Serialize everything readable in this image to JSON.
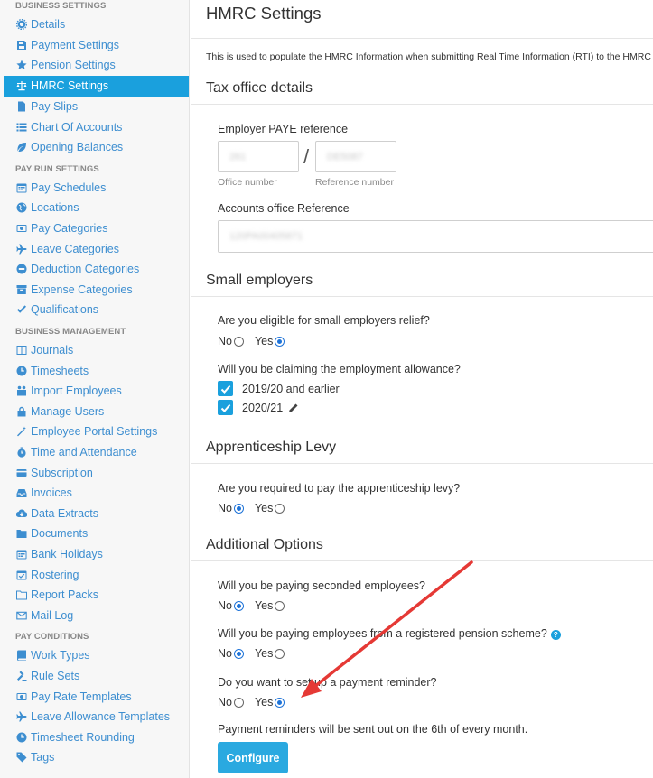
{
  "sidebar": {
    "sections": [
      {
        "title": "BUSINESS SETTINGS",
        "items": [
          {
            "label": "Details",
            "icon": "gear-icon"
          },
          {
            "label": "Payment Settings",
            "icon": "save-icon"
          },
          {
            "label": "Pension Settings",
            "icon": "star-icon"
          },
          {
            "label": "HMRC Settings",
            "icon": "scale-icon",
            "active": true
          },
          {
            "label": "Pay Slips",
            "icon": "file-icon"
          },
          {
            "label": "Chart Of Accounts",
            "icon": "list-icon"
          },
          {
            "label": "Opening Balances",
            "icon": "leaf-icon"
          }
        ]
      },
      {
        "title": "PAY RUN SETTINGS",
        "items": [
          {
            "label": "Pay Schedules",
            "icon": "calendar-icon"
          },
          {
            "label": "Locations",
            "icon": "globe-icon"
          },
          {
            "label": "Pay Categories",
            "icon": "money-icon"
          },
          {
            "label": "Leave Categories",
            "icon": "plane-icon"
          },
          {
            "label": "Deduction Categories",
            "icon": "minus-circle-icon"
          },
          {
            "label": "Expense Categories",
            "icon": "archive-icon"
          },
          {
            "label": "Qualifications",
            "icon": "check-icon"
          }
        ]
      },
      {
        "title": "BUSINESS MANAGEMENT",
        "items": [
          {
            "label": "Journals",
            "icon": "columns-icon"
          },
          {
            "label": "Timesheets",
            "icon": "clock-icon"
          },
          {
            "label": "Import Employees",
            "icon": "users-icon"
          },
          {
            "label": "Manage Users",
            "icon": "lock-icon"
          },
          {
            "label": "Employee Portal Settings",
            "icon": "magic-wand-icon"
          },
          {
            "label": "Time and Attendance",
            "icon": "stopwatch-icon"
          },
          {
            "label": "Subscription",
            "icon": "credit-card-icon"
          },
          {
            "label": "Invoices",
            "icon": "inbox-icon"
          },
          {
            "label": "Data Extracts",
            "icon": "cloud-download-icon"
          },
          {
            "label": "Documents",
            "icon": "folder-icon"
          },
          {
            "label": "Bank Holidays",
            "icon": "calendar-icon"
          },
          {
            "label": "Rostering",
            "icon": "calendar-check-icon"
          },
          {
            "label": "Report Packs",
            "icon": "folder-open-icon"
          },
          {
            "label": "Mail Log",
            "icon": "envelope-icon"
          }
        ]
      },
      {
        "title": "PAY CONDITIONS",
        "items": [
          {
            "label": "Work Types",
            "icon": "book-icon"
          },
          {
            "label": "Rule Sets",
            "icon": "gavel-icon"
          },
          {
            "label": "Pay Rate Templates",
            "icon": "money-icon"
          },
          {
            "label": "Leave Allowance Templates",
            "icon": "plane-icon"
          },
          {
            "label": "Timesheet Rounding",
            "icon": "clock-icon"
          },
          {
            "label": "Tags",
            "icon": "tag-icon"
          }
        ]
      }
    ]
  },
  "main": {
    "title": "HMRC Settings",
    "intro": "This is used to populate the HMRC Information when submitting Real Time Information (RTI) to the HMRC",
    "tax_office": {
      "heading": "Tax office details",
      "paye_label": "Employer PAYE reference",
      "office_number_value": "261",
      "office_number_label": "Office number",
      "separator": "/",
      "reference_number_value": "DE5087",
      "reference_number_label": "Reference number",
      "accounts_office_label": "Accounts office Reference",
      "accounts_office_value": "120PA00405871"
    },
    "small_employers": {
      "heading": "Small employers",
      "relief_question": "Are you eligible for small employers relief?",
      "relief_options": [
        "No",
        "Yes"
      ],
      "relief_selected": "Yes",
      "allowance_question": "Will you be claiming the employment allowance?",
      "allowance_years": [
        {
          "label": "2019/20 and earlier",
          "checked": true
        },
        {
          "label": "2020/21",
          "checked": true
        }
      ]
    },
    "apprenticeship": {
      "heading": "Apprenticeship Levy",
      "question": "Are you required to pay the apprenticeship levy?",
      "options": [
        "No",
        "Yes"
      ],
      "selected": "No"
    },
    "additional": {
      "heading": "Additional Options",
      "seconded_question": "Will you be paying seconded employees?",
      "seconded_selected": "No",
      "pension_question": "Will you be paying employees from a registered pension scheme?",
      "pension_selected": "No",
      "reminder_question": "Do you want to set up a payment reminder?",
      "reminder_selected": "Yes",
      "options": [
        "No",
        "Yes"
      ],
      "reminder_note": "Payment reminders will be sent out on the 6th of every month.",
      "configure_label": "Configure"
    }
  },
  "colors": {
    "accent": "#1aa0dd",
    "link": "#3d8ed0",
    "arrow": "#e53935"
  }
}
